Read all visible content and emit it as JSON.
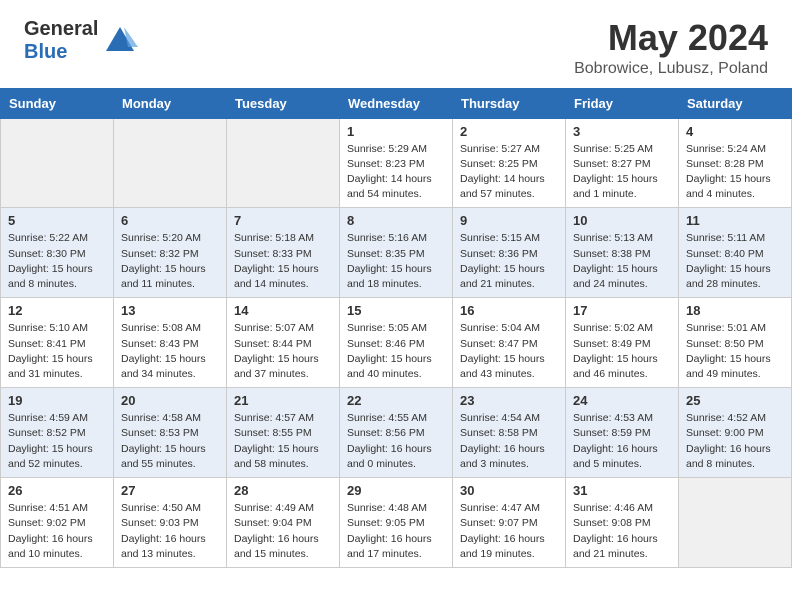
{
  "header": {
    "logo_general": "General",
    "logo_blue": "Blue",
    "title": "May 2024",
    "location": "Bobrowice, Lubusz, Poland"
  },
  "calendar": {
    "days_of_week": [
      "Sunday",
      "Monday",
      "Tuesday",
      "Wednesday",
      "Thursday",
      "Friday",
      "Saturday"
    ],
    "weeks": [
      [
        {
          "day": "",
          "info": ""
        },
        {
          "day": "",
          "info": ""
        },
        {
          "day": "",
          "info": ""
        },
        {
          "day": "1",
          "info": "Sunrise: 5:29 AM\nSunset: 8:23 PM\nDaylight: 14 hours\nand 54 minutes."
        },
        {
          "day": "2",
          "info": "Sunrise: 5:27 AM\nSunset: 8:25 PM\nDaylight: 14 hours\nand 57 minutes."
        },
        {
          "day": "3",
          "info": "Sunrise: 5:25 AM\nSunset: 8:27 PM\nDaylight: 15 hours\nand 1 minute."
        },
        {
          "day": "4",
          "info": "Sunrise: 5:24 AM\nSunset: 8:28 PM\nDaylight: 15 hours\nand 4 minutes."
        }
      ],
      [
        {
          "day": "5",
          "info": "Sunrise: 5:22 AM\nSunset: 8:30 PM\nDaylight: 15 hours\nand 8 minutes."
        },
        {
          "day": "6",
          "info": "Sunrise: 5:20 AM\nSunset: 8:32 PM\nDaylight: 15 hours\nand 11 minutes."
        },
        {
          "day": "7",
          "info": "Sunrise: 5:18 AM\nSunset: 8:33 PM\nDaylight: 15 hours\nand 14 minutes."
        },
        {
          "day": "8",
          "info": "Sunrise: 5:16 AM\nSunset: 8:35 PM\nDaylight: 15 hours\nand 18 minutes."
        },
        {
          "day": "9",
          "info": "Sunrise: 5:15 AM\nSunset: 8:36 PM\nDaylight: 15 hours\nand 21 minutes."
        },
        {
          "day": "10",
          "info": "Sunrise: 5:13 AM\nSunset: 8:38 PM\nDaylight: 15 hours\nand 24 minutes."
        },
        {
          "day": "11",
          "info": "Sunrise: 5:11 AM\nSunset: 8:40 PM\nDaylight: 15 hours\nand 28 minutes."
        }
      ],
      [
        {
          "day": "12",
          "info": "Sunrise: 5:10 AM\nSunset: 8:41 PM\nDaylight: 15 hours\nand 31 minutes."
        },
        {
          "day": "13",
          "info": "Sunrise: 5:08 AM\nSunset: 8:43 PM\nDaylight: 15 hours\nand 34 minutes."
        },
        {
          "day": "14",
          "info": "Sunrise: 5:07 AM\nSunset: 8:44 PM\nDaylight: 15 hours\nand 37 minutes."
        },
        {
          "day": "15",
          "info": "Sunrise: 5:05 AM\nSunset: 8:46 PM\nDaylight: 15 hours\nand 40 minutes."
        },
        {
          "day": "16",
          "info": "Sunrise: 5:04 AM\nSunset: 8:47 PM\nDaylight: 15 hours\nand 43 minutes."
        },
        {
          "day": "17",
          "info": "Sunrise: 5:02 AM\nSunset: 8:49 PM\nDaylight: 15 hours\nand 46 minutes."
        },
        {
          "day": "18",
          "info": "Sunrise: 5:01 AM\nSunset: 8:50 PM\nDaylight: 15 hours\nand 49 minutes."
        }
      ],
      [
        {
          "day": "19",
          "info": "Sunrise: 4:59 AM\nSunset: 8:52 PM\nDaylight: 15 hours\nand 52 minutes."
        },
        {
          "day": "20",
          "info": "Sunrise: 4:58 AM\nSunset: 8:53 PM\nDaylight: 15 hours\nand 55 minutes."
        },
        {
          "day": "21",
          "info": "Sunrise: 4:57 AM\nSunset: 8:55 PM\nDaylight: 15 hours\nand 58 minutes."
        },
        {
          "day": "22",
          "info": "Sunrise: 4:55 AM\nSunset: 8:56 PM\nDaylight: 16 hours\nand 0 minutes."
        },
        {
          "day": "23",
          "info": "Sunrise: 4:54 AM\nSunset: 8:58 PM\nDaylight: 16 hours\nand 3 minutes."
        },
        {
          "day": "24",
          "info": "Sunrise: 4:53 AM\nSunset: 8:59 PM\nDaylight: 16 hours\nand 5 minutes."
        },
        {
          "day": "25",
          "info": "Sunrise: 4:52 AM\nSunset: 9:00 PM\nDaylight: 16 hours\nand 8 minutes."
        }
      ],
      [
        {
          "day": "26",
          "info": "Sunrise: 4:51 AM\nSunset: 9:02 PM\nDaylight: 16 hours\nand 10 minutes."
        },
        {
          "day": "27",
          "info": "Sunrise: 4:50 AM\nSunset: 9:03 PM\nDaylight: 16 hours\nand 13 minutes."
        },
        {
          "day": "28",
          "info": "Sunrise: 4:49 AM\nSunset: 9:04 PM\nDaylight: 16 hours\nand 15 minutes."
        },
        {
          "day": "29",
          "info": "Sunrise: 4:48 AM\nSunset: 9:05 PM\nDaylight: 16 hours\nand 17 minutes."
        },
        {
          "day": "30",
          "info": "Sunrise: 4:47 AM\nSunset: 9:07 PM\nDaylight: 16 hours\nand 19 minutes."
        },
        {
          "day": "31",
          "info": "Sunrise: 4:46 AM\nSunset: 9:08 PM\nDaylight: 16 hours\nand 21 minutes."
        },
        {
          "day": "",
          "info": ""
        }
      ]
    ]
  }
}
